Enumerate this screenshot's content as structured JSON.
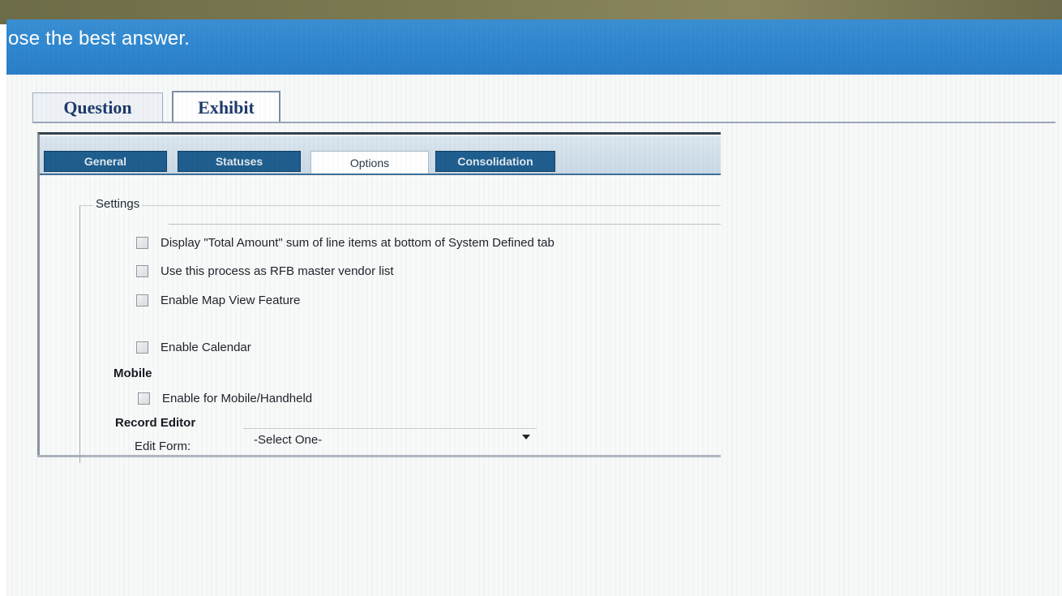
{
  "header": {
    "title": "ose the best answer."
  },
  "main_tabs": [
    {
      "label": "Question",
      "active": false
    },
    {
      "label": "Exhibit",
      "active": true
    }
  ],
  "sub_tabs": [
    {
      "label": "General",
      "active": false
    },
    {
      "label": "Statuses",
      "active": false
    },
    {
      "label": "Options",
      "active": true
    },
    {
      "label": "Consolidation",
      "active": false
    }
  ],
  "settings": {
    "legend": "Settings",
    "options": [
      {
        "label": "Display \"Total Amount\" sum of line items at bottom of System Defined tab",
        "checked": false
      },
      {
        "label": "Use this process as RFB master vendor list",
        "checked": false
      },
      {
        "label": "Enable Map View Feature",
        "checked": false
      },
      {
        "label": "Enable Calendar",
        "checked": false
      }
    ]
  },
  "mobile": {
    "heading": "Mobile",
    "option": {
      "label": "Enable for Mobile/Handheld",
      "checked": false
    }
  },
  "record_editor": {
    "heading": "Record Editor",
    "edit_form_label": "Edit Form:",
    "edit_form_value": "-Select One-"
  },
  "colors": {
    "header_blue": "#2e86cf",
    "subtab_dark": "#1f5e8e",
    "tab_text": "#1f3b6b"
  }
}
